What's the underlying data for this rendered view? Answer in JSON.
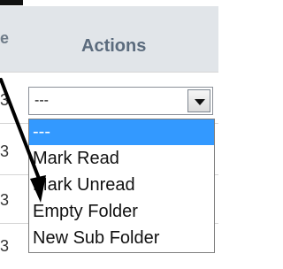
{
  "header": {
    "partial_left": "e",
    "title": "Actions"
  },
  "rows": [
    {
      "partial": "3"
    },
    {
      "partial": "3"
    },
    {
      "partial": "3"
    },
    {
      "partial": "3"
    },
    {
      "partial": "3"
    }
  ],
  "select": {
    "value": "---",
    "button_icon": "dropdown-arrow-icon"
  },
  "dropdown": {
    "options": [
      "---",
      "Mark Read",
      "Mark Unread",
      "Empty Folder",
      "New Sub Folder"
    ],
    "selected": "---"
  },
  "colors": {
    "header_bg": "#e1e5e9",
    "selection": "#3399ff"
  }
}
